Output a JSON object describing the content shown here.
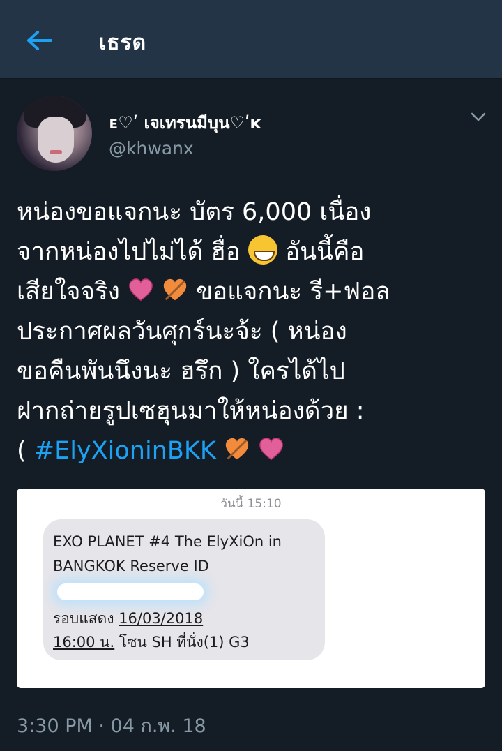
{
  "header": {
    "title": "เธรด"
  },
  "tweet": {
    "display_name": "ᴇ♡ʹ เจเทรนมีบุน♡ʹᴋ",
    "handle": "@khwanx",
    "lines": [
      "หน่องขอแจกนะ บัตร 6,000 เนื่อง",
      "จากหน่องไปไม่ได้ ฮื่อ",
      "อันนี้คือ",
      "เสียใจจริง",
      "ขอแจกนะ รี+ฟอล",
      "ประกาศผลวันศุกร์นะจ้ะ ( หน่อง",
      "ขอคืนพันนึงนะ ฮรึก ) ใครได้ไป",
      "ฝากถ่ายรูปเซฮุนมาให้หน่องด้วย :",
      "("
    ],
    "hashtag": "#ElyXioninBKK",
    "timestamp": "3:30 PM · 04 ก.พ. 18"
  },
  "media": {
    "time_label": "วันนี้ 15:10",
    "message_line1": "EXO PLANET #4 The ElyXiOn in",
    "message_line2": "BANGKOK Reserve ID",
    "show_label": "รอบแสดง",
    "show_date": "16/03/2018",
    "show_time": "16:00 น.",
    "seat_info": "โซน SH ที่นั่ง(1) G3"
  },
  "icons": {
    "back": "arrow-left-icon",
    "more": "chevron-down-icon",
    "emoji_joy": "face-with-tears-of-joy-icon",
    "heart": "heart-icon",
    "heart_arrow": "heart-with-arrow-icon"
  },
  "colors": {
    "background": "#141d26",
    "header": "#243447",
    "accent": "#1da1f2",
    "muted": "#8899a6"
  }
}
